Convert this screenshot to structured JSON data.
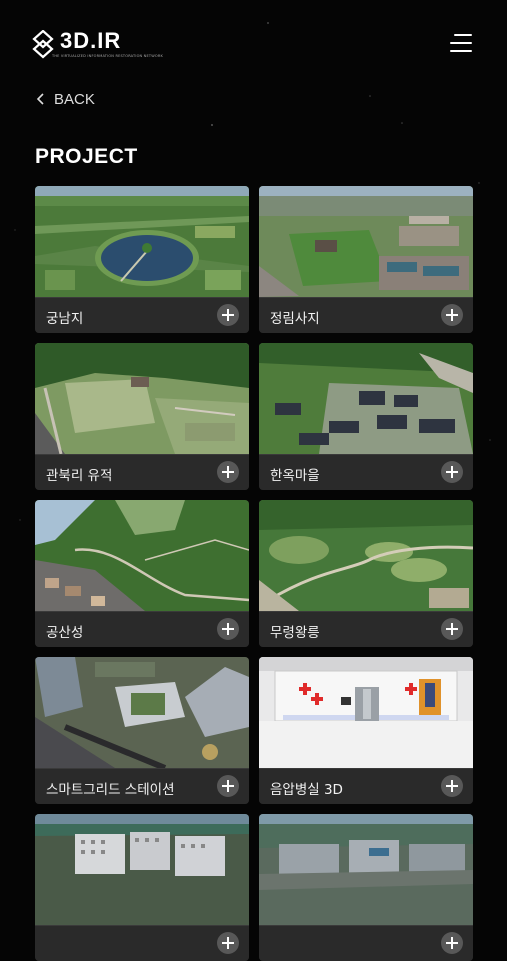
{
  "header": {
    "logo_text": "3D.IR",
    "logo_subtitle": "THE VIRTUALIZED INFORMATION RESTORATION NETWORK",
    "menu_icon": "hamburger-icon"
  },
  "nav": {
    "back_label": "BACK",
    "back_icon": "chevron-left-icon"
  },
  "page": {
    "title": "PROJECT"
  },
  "projects": [
    {
      "name": "궁남지"
    },
    {
      "name": "정림사지"
    },
    {
      "name": "관북리 유적"
    },
    {
      "name": "한옥마을"
    },
    {
      "name": "공산성"
    },
    {
      "name": "무령왕릉"
    },
    {
      "name": "스마트그리드 스테이션"
    },
    {
      "name": "음압병실 3D"
    },
    {
      "name": ""
    },
    {
      "name": ""
    }
  ],
  "colors": {
    "background": "#050505",
    "card_bar": "#2a2a2a",
    "plus_button": "#585858",
    "foliage": "#3f7a34",
    "water": "#2b4d6e",
    "accent_red": "#e02b2b",
    "accent_orange": "#e0922b"
  }
}
